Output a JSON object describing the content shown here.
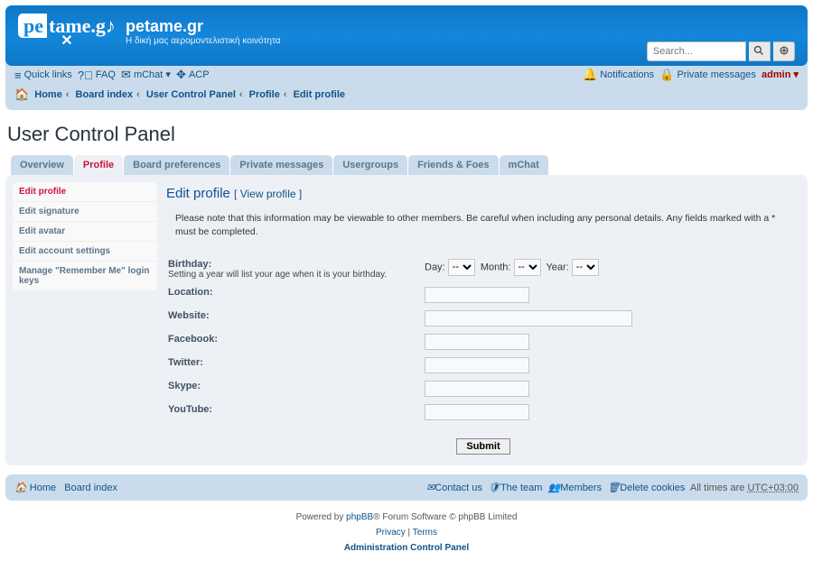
{
  "header": {
    "site_title": "petame.gr",
    "site_desc": "Η δική μας αερομοντελιστική κοινότητα",
    "search_placeholder": "Search..."
  },
  "nav": {
    "quick": "Quick links",
    "faq": "FAQ",
    "mchat": "mChat",
    "acp": "ACP",
    "notif": "Notifications",
    "pm": "Private messages",
    "user": "admin",
    "crumbs": [
      "Home",
      "Board index",
      "User Control Panel",
      "Profile",
      "Edit profile"
    ]
  },
  "page_title": "User Control Panel",
  "tabs": [
    "Overview",
    "Profile",
    "Board preferences",
    "Private messages",
    "Usergroups",
    "Friends & Foes",
    "mChat"
  ],
  "active_tab": 1,
  "side": [
    "Edit profile",
    "Edit signature",
    "Edit avatar",
    "Edit account settings",
    "Manage \"Remember Me\" login keys"
  ],
  "active_side": 0,
  "main": {
    "heading": "Edit profile",
    "view_profile": "View profile",
    "note": "Please note that this information may be viewable to other members. Be careful when including any personal details. Any fields marked with a * must be completed.",
    "bday_label": "Birthday:",
    "bday_hint": "Setting a year will list your age when it is your birthday.",
    "day": "Day:",
    "month": "Month:",
    "year": "Year:",
    "dash": "--",
    "loc": "Location:",
    "web": "Website:",
    "fb": "Facebook:",
    "tw": "Twitter:",
    "sk": "Skype:",
    "yt": "YouTube:",
    "submit": "Submit"
  },
  "btm": {
    "home": "Home",
    "bi": "Board index",
    "contact": "Contact us",
    "team": "The team",
    "members": "Members",
    "del": "Delete cookies",
    "tz_pre": "All times are ",
    "tz": "UTC+03:00"
  },
  "ftr": {
    "pb": "Powered by ",
    "phpbb": "phpBB",
    "rest": "® Forum Software © phpBB Limited",
    "priv": "Privacy",
    "terms": "Terms",
    "acp": "Administration Control Panel",
    "pipe": " | "
  }
}
